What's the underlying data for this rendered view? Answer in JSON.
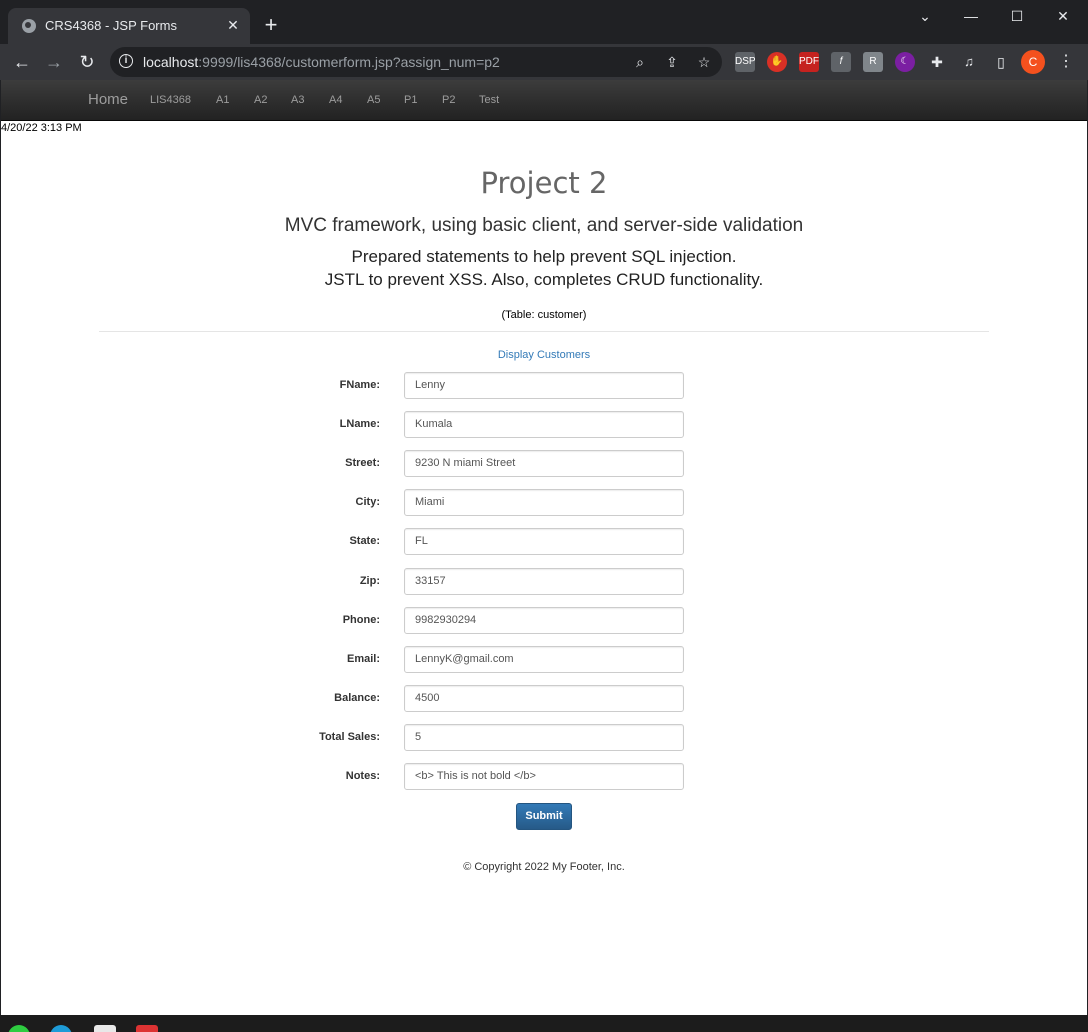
{
  "browser": {
    "tab_title": "CRS4368 - JSP Forms",
    "tab_close": "✕",
    "new_tab": "+",
    "url_host": "localhost",
    "url_path": ":9999/lis4368/customerform.jsp?assign_num=p2",
    "profile_initial": "C",
    "extensions": [
      "DSP",
      "✋",
      "PDF",
      "f",
      "R",
      "☾",
      "✚"
    ],
    "icons": {
      "back": "←",
      "forward": "→",
      "reload": "↻",
      "info": "i",
      "zoom": "⌕",
      "share": "⇪",
      "star": "☆",
      "menu": "⋮",
      "minimize": "—",
      "maximize": "☐",
      "close": "✕",
      "tabsearch": "⌄",
      "media": "♫",
      "sidepanel": "▯"
    }
  },
  "nav": {
    "brand": "Home",
    "links": [
      "LIS4368",
      "A1",
      "A2",
      "A3",
      "A4",
      "A5",
      "P1",
      "P2",
      "Test"
    ]
  },
  "page": {
    "date": "4/20/22 3:13 PM",
    "title": "Project 2",
    "subtitle": "MVC framework, using basic client, and server-side validation",
    "line1": "Prepared statements to help prevent SQL injection.",
    "line2": "JSTL to prevent XSS. Also, completes CRUD functionality.",
    "table_note": "(Table: customer)",
    "display_link": "Display Customers",
    "submit": "Submit",
    "footer": "© Copyright 2022 My Footer, Inc."
  },
  "form": {
    "fields": [
      {
        "label": "FName:",
        "value": "Lenny"
      },
      {
        "label": "LName:",
        "value": "Kumala"
      },
      {
        "label": "Street:",
        "value": "9230 N miami Street"
      },
      {
        "label": "City:",
        "value": "Miami"
      },
      {
        "label": "State:",
        "value": "FL"
      },
      {
        "label": "Zip:",
        "value": "33157"
      },
      {
        "label": "Phone:",
        "value": "9982930294"
      },
      {
        "label": "Email:",
        "value": "LennyK@gmail.com"
      },
      {
        "label": "Balance:",
        "value": "4500"
      },
      {
        "label": "Total Sales:",
        "value": "5"
      },
      {
        "label": "Notes:",
        "value": "<b> This is not bold </b>"
      }
    ]
  },
  "colors": {
    "chrome_dark": "#202124",
    "chrome_toolbar": "#35363a",
    "link_blue": "#337ab7",
    "button_blue": "#265a88",
    "profile_orange": "#f4511e"
  }
}
